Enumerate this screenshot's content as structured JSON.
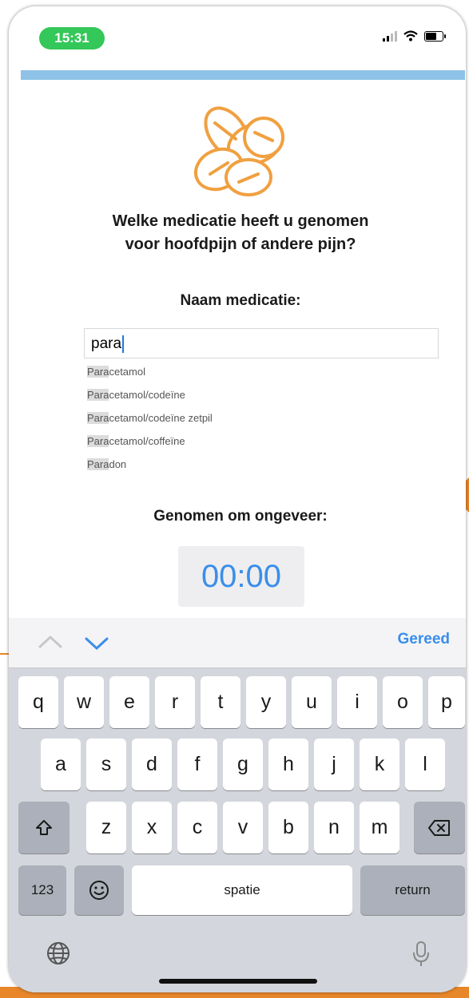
{
  "status_bar": {
    "time": "15:31",
    "icons": [
      "cellular-signal-icon",
      "wifi-icon",
      "battery-icon"
    ]
  },
  "progress": {
    "label": ""
  },
  "question": {
    "line1": "Welke medicatie heeft u genomen",
    "line2": "voor hoofdpijn of andere pijn?"
  },
  "medication": {
    "label": "Naam medicatie:",
    "input_value": "para",
    "suggestions": [
      {
        "match": "Para",
        "rest": "cetamol"
      },
      {
        "match": "Para",
        "rest": "cetamol/codeïne"
      },
      {
        "match": "Para",
        "rest": "cetamol/codeïne zetpil"
      },
      {
        "match": "Para",
        "rest": "cetamol/coffeïne"
      },
      {
        "match": "Para",
        "rest": "don"
      }
    ]
  },
  "taken_time": {
    "label": "Genomen om ongeveer:",
    "value": "00:00"
  },
  "keyboard": {
    "done_label": "Gereed",
    "row1": [
      "q",
      "w",
      "e",
      "r",
      "t",
      "y",
      "u",
      "i",
      "o",
      "p"
    ],
    "row2": [
      "a",
      "s",
      "d",
      "f",
      "g",
      "h",
      "j",
      "k",
      "l"
    ],
    "row3": [
      "z",
      "x",
      "c",
      "v",
      "b",
      "n",
      "m"
    ],
    "numbers_label": "123",
    "space_label": "spatie",
    "return_label": "return"
  },
  "colors": {
    "accent": "#3a8eea",
    "icon_orange": "#f0a040",
    "status_green": "#34c759",
    "slide_orange": "#e8862a"
  }
}
